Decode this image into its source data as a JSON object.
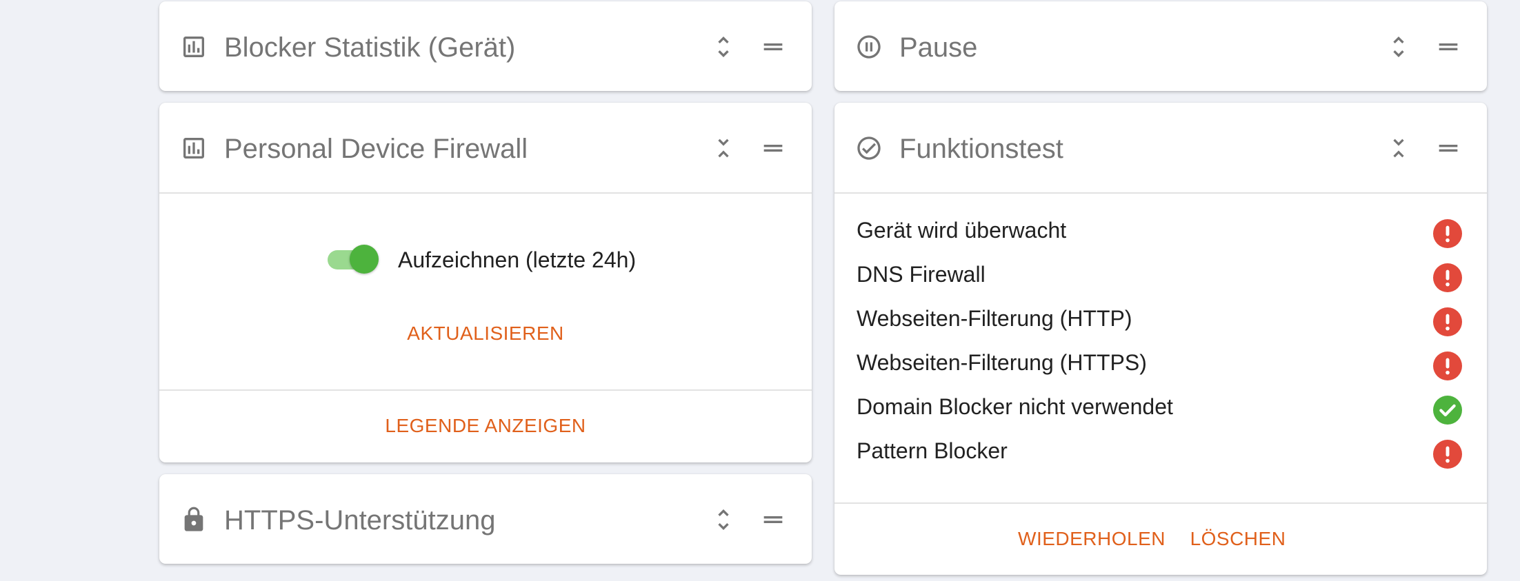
{
  "colors": {
    "accent": "#e0601b",
    "error": "#e2493b",
    "success": "#4db33d",
    "title": "#757575"
  },
  "cards": {
    "blocker_stats": {
      "title": "Blocker Statistik (Gerät)",
      "icon": "bar-chart-icon",
      "expanded": false
    },
    "pause": {
      "title": "Pause",
      "icon": "pause-circle-icon",
      "expanded": false
    },
    "firewall": {
      "title": "Personal Device Firewall",
      "icon": "bar-chart-icon",
      "expanded": true,
      "record_toggle": {
        "label": "Aufzeichnen (letzte 24h)",
        "on": true
      },
      "refresh_label": "AKTUALISIEREN",
      "legend_label": "LEGENDE ANZEIGEN"
    },
    "function_test": {
      "title": "Funktionstest",
      "icon": "check-circle-icon",
      "expanded": true,
      "items": [
        {
          "label": "Gerät wird überwacht",
          "status": "error"
        },
        {
          "label": "DNS Firewall",
          "status": "error"
        },
        {
          "label": "Webseiten-Filterung (HTTP)",
          "status": "error"
        },
        {
          "label": "Webseiten-Filterung (HTTPS)",
          "status": "error"
        },
        {
          "label": "Domain Blocker nicht verwendet",
          "status": "ok"
        },
        {
          "label": "Pattern Blocker",
          "status": "error"
        }
      ],
      "repeat_label": "WIEDERHOLEN",
      "delete_label": "LÖSCHEN"
    },
    "https": {
      "title": "HTTPS-Unterstützung",
      "icon": "lock-icon",
      "expanded": false
    }
  }
}
